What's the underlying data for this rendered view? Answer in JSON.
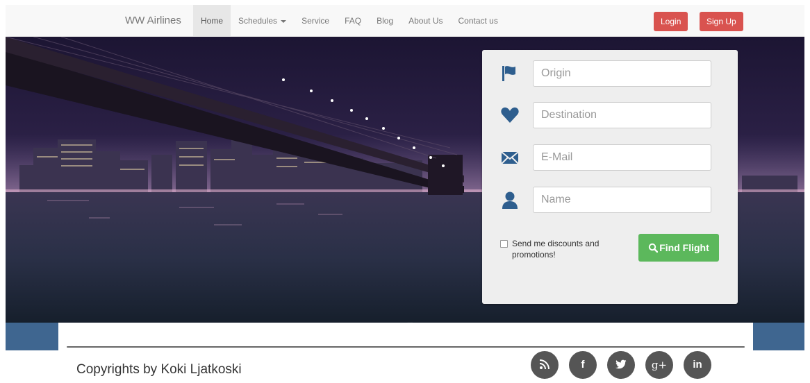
{
  "navbar": {
    "brand": "WW Airlines",
    "items": [
      {
        "label": "Home",
        "active": true
      },
      {
        "label": "Schedules",
        "dropdown": true
      },
      {
        "label": "Service"
      },
      {
        "label": "FAQ"
      },
      {
        "label": "Blog"
      },
      {
        "label": "About Us"
      },
      {
        "label": "Contact us"
      }
    ],
    "login_label": "Login",
    "signup_label": "Sign Up"
  },
  "search_form": {
    "origin": {
      "placeholder": "Origin",
      "icon": "flag-icon"
    },
    "destination": {
      "placeholder": "Destination",
      "icon": "heart-icon"
    },
    "email": {
      "placeholder": "E-Mail",
      "icon": "envelope-icon"
    },
    "name": {
      "placeholder": "Name",
      "icon": "user-icon"
    },
    "promo_checkbox_label": "Send me discounts and promotions!",
    "find_button_label": "Find Flight"
  },
  "hero": {
    "indicator": "..."
  },
  "footer": {
    "copyright": "Copyrights by Koki Ljatkoski",
    "social": [
      {
        "name": "rss",
        "glyph": "⚇"
      },
      {
        "name": "facebook",
        "glyph": "f"
      },
      {
        "name": "twitter",
        "glyph": "t"
      },
      {
        "name": "google-plus",
        "glyph": "g+"
      },
      {
        "name": "linkedin",
        "glyph": "in"
      }
    ]
  },
  "colors": {
    "navbar_bg": "#f8f8f8",
    "login_red": "#d9534f",
    "find_green": "#5cb85c",
    "icon_blue": "#2e5e8e",
    "footer_band": "#3f6690",
    "social_bg": "#555555"
  }
}
